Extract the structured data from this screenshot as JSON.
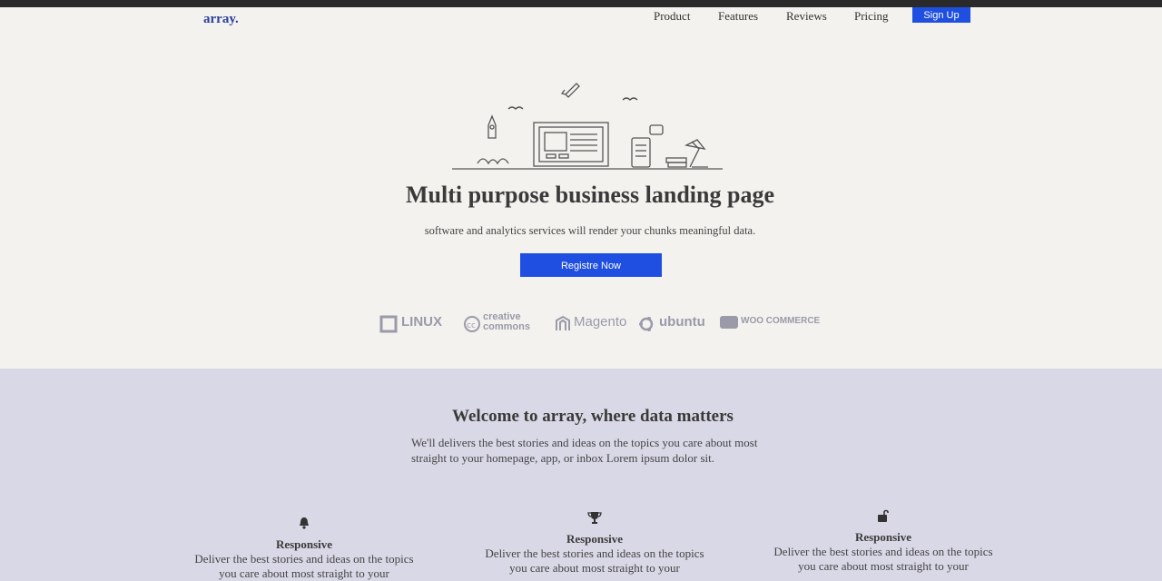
{
  "nav": {
    "logo": "array.",
    "links": [
      "Product",
      "Features",
      "Reviews",
      "Pricing"
    ],
    "signup_label": "Sign Up"
  },
  "hero": {
    "title": "Multi purpose business landing page",
    "subtitle": "software and analytics services will render your chunks meaningful data.",
    "cta_label": "Registre Now",
    "illustration_icon": "workspace-illustration",
    "brands": [
      {
        "name": "LINUX",
        "icon": "linux-logo-icon"
      },
      {
        "name": "creative commons",
        "icon": "cc-logo-icon"
      },
      {
        "name": "Magento",
        "icon": "magento-logo-icon"
      },
      {
        "name": "ubuntu",
        "icon": "ubuntu-logo-icon"
      },
      {
        "name": "WOO COMMERCE",
        "icon": "woocommerce-logo-icon"
      }
    ]
  },
  "welcome": {
    "title": "Welcome to array, where data matters",
    "description": "We'll delivers the best stories and ideas on the topics you care about most straight to your homepage, app, or inbox Lorem ipsum dolor sit.",
    "features": [
      {
        "icon": "bell-icon",
        "title": "Responsive",
        "text": "Deliver the best stories and ideas on the topics you care about most straight to your"
      },
      {
        "icon": "trophy-icon",
        "title": "Responsive",
        "text": "Deliver the best stories and ideas on the topics you care about most straight to your"
      },
      {
        "icon": "unlock-icon",
        "title": "Responsive",
        "text": "Deliver the best stories and ideas on the topics you care about most straight to your"
      }
    ]
  },
  "colors": {
    "primary": "#1f4fe0",
    "logo": "#2b3f9a"
  }
}
